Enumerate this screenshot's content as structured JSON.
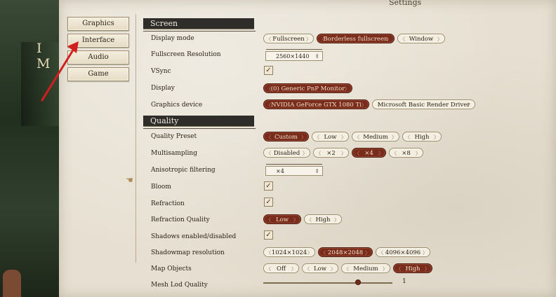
{
  "window": {
    "title": "Settings"
  },
  "background": {
    "letters": "I M"
  },
  "nav": {
    "items": [
      "Graphics",
      "Interface",
      "Audio",
      "Game"
    ]
  },
  "screen": {
    "header": "Screen",
    "display_mode": {
      "label": "Display mode",
      "options": [
        "Fullscreen",
        "Borderless fullscreen",
        "Window"
      ],
      "selected": "Borderless fullscreen"
    },
    "fullscreen_resolution": {
      "label": "Fullscreen Resolution",
      "value": "2560×1440"
    },
    "vsync": {
      "label": "VSync",
      "checked": true
    },
    "display": {
      "label": "Display",
      "value": "(0) Generic PnP Monitor"
    },
    "graphics_device": {
      "label": "Graphics device",
      "options": [
        "NVIDIA GeForce GTX 1080 Ti",
        "Microsoft Basic Render Driver"
      ],
      "selected": "NVIDIA GeForce GTX 1080 Ti"
    }
  },
  "quality": {
    "header": "Quality",
    "preset": {
      "label": "Quality Preset",
      "options": [
        "Custom",
        "Low",
        "Medium",
        "High"
      ],
      "selected": "Custom"
    },
    "multisampling": {
      "label": "Multisampling",
      "options": [
        "Disabled",
        "×2",
        "×4",
        "×8"
      ],
      "selected": "×4"
    },
    "anisotropic": {
      "label": "Anisotropic filtering",
      "value": "×4"
    },
    "bloom": {
      "label": "Bloom",
      "checked": true
    },
    "refraction": {
      "label": "Refraction",
      "checked": true
    },
    "refraction_quality": {
      "label": "Refraction Quality",
      "options": [
        "Low",
        "High"
      ],
      "selected": "Low"
    },
    "shadows": {
      "label": "Shadows enabled/disabled",
      "checked": true
    },
    "shadowmap": {
      "label": "Shadowmap resolution",
      "options": [
        "1024×1024",
        "2048×2048",
        "4096×4096"
      ],
      "selected": "2048×2048"
    },
    "map_objects": {
      "label": "Map Objects",
      "options": [
        "Off",
        "Low",
        "Medium",
        "High"
      ],
      "selected": "High"
    },
    "mesh_lod": {
      "label": "Mesh Lod Quality",
      "value": "1",
      "fraction": 0.72
    }
  },
  "icons": {
    "checkbox": "checkmark-icon",
    "dropdown": "chevron-updown-icon",
    "cursor": "hand-pointer-icon",
    "annotation": "red-arrow-icon"
  },
  "colors": {
    "selected": "#7a2c1c",
    "header": "#2f2d2a",
    "arrow": "#d11f1f"
  }
}
